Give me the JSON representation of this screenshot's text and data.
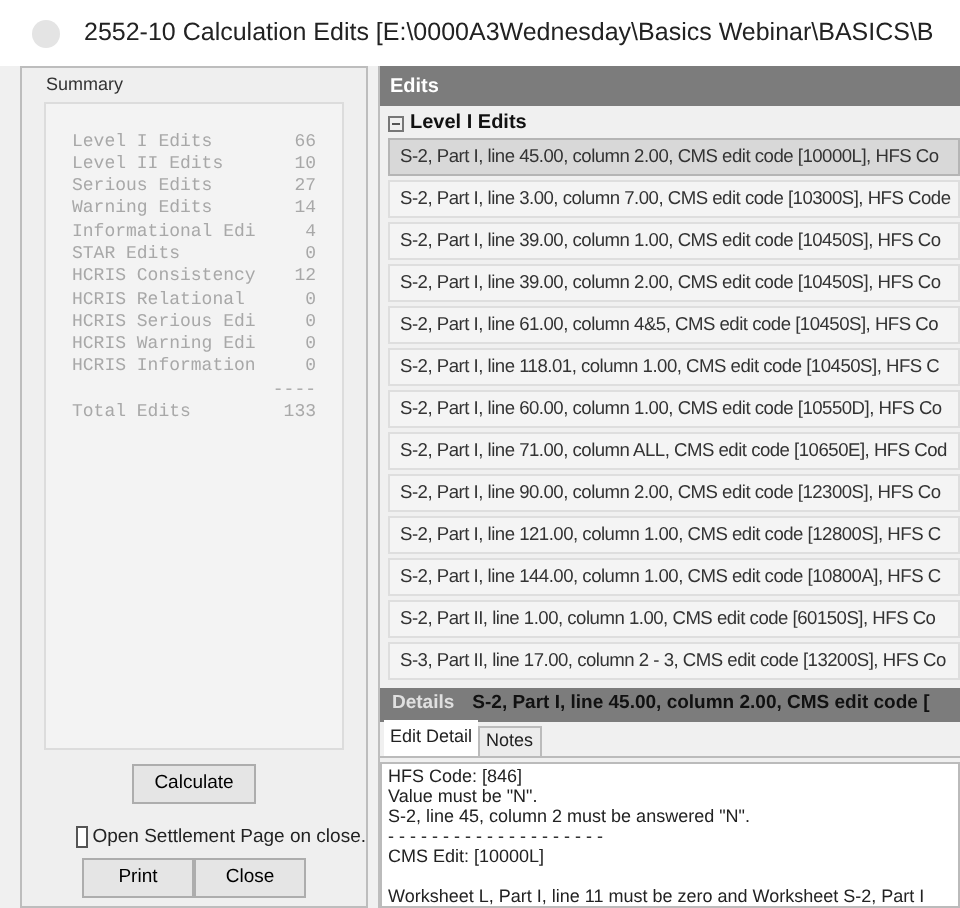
{
  "window": {
    "title": "2552-10 Calculation Edits [E:\\0000A3Wednesday\\Basics Webinar\\BASICS\\B"
  },
  "summary": {
    "title": "Summary",
    "rows": [
      {
        "label": "Level I Edits",
        "value": "66"
      },
      {
        "label": "Level II Edits",
        "value": "10"
      },
      {
        "label": "Serious Edits",
        "value": "27"
      },
      {
        "label": "Warning Edits",
        "value": "14"
      },
      {
        "label": "Informational Edi",
        "value": "4"
      },
      {
        "label": "STAR Edits",
        "value": "0"
      },
      {
        "label": "HCRIS Consistency",
        "value": "12"
      },
      {
        "label": "HCRIS Relational",
        "value": "0"
      },
      {
        "label": "HCRIS Serious Edi",
        "value": "0"
      },
      {
        "label": "HCRIS Warning Edi",
        "value": "0"
      },
      {
        "label": "HCRIS Information",
        "value": "0"
      }
    ],
    "separator": "----",
    "total": {
      "label": "Total Edits",
      "value": "133"
    },
    "calculate_button": "Calculate",
    "open_settlement": {
      "label": "Open Settlement Page on close.",
      "checked": false
    },
    "buttons": [
      "Print",
      "Close"
    ]
  },
  "edits": {
    "title": "Edits",
    "group": {
      "label": "Level I Edits",
      "expanded": true
    },
    "rows": [
      {
        "text": "S-2, Part I, line 45.00, column 2.00, CMS edit code [10000L], HFS Co",
        "selected": true
      },
      {
        "text": "S-2, Part I, line 3.00, column 7.00, CMS edit code [10300S], HFS Code",
        "selected": false
      },
      {
        "text": "S-2, Part I, line 39.00, column 1.00, CMS edit code [10450S], HFS Co",
        "selected": false
      },
      {
        "text": "S-2, Part I, line 39.00, column 2.00, CMS edit code [10450S], HFS Co",
        "selected": false
      },
      {
        "text": "S-2, Part I, line 61.00, column 4&5, CMS edit code [10450S], HFS Co",
        "selected": false
      },
      {
        "text": "S-2, Part I, line 118.01, column 1.00, CMS edit code [10450S], HFS C",
        "selected": false
      },
      {
        "text": "S-2, Part I, line 60.00, column 1.00, CMS edit code [10550D], HFS Co",
        "selected": false
      },
      {
        "text": "S-2, Part I, line 71.00, column ALL, CMS edit code [10650E], HFS Cod",
        "selected": false
      },
      {
        "text": "S-2, Part I, line 90.00, column 2.00, CMS edit code [12300S], HFS Co",
        "selected": false
      },
      {
        "text": "S-2, Part I, line 121.00, column 1.00, CMS edit code [12800S], HFS C",
        "selected": false
      },
      {
        "text": "S-2, Part I, line 144.00, column 1.00, CMS edit code [10800A], HFS C",
        "selected": false
      },
      {
        "text": "S-2, Part II, line 1.00, column 1.00, CMS edit code [60150S], HFS Co",
        "selected": false
      },
      {
        "text": "S-3, Part II, line 17.00, column 2 - 3, CMS edit code [13200S], HFS Co",
        "selected": false
      }
    ]
  },
  "details": {
    "title": "Details",
    "heading": "S-2, Part I, line 45.00, column 2.00, CMS edit code [",
    "tabs": [
      {
        "label": "Edit Detail",
        "selected": true
      },
      {
        "label": "Notes",
        "selected": false
      }
    ],
    "lines": [
      {
        "text": "HFS Code: [846]",
        "spaced": false
      },
      {
        "text": "Value must be \"N\".",
        "spaced": false
      },
      {
        "text": "S-2, line 45, column 2 must be answered \"N\".",
        "spaced": false
      },
      {
        "text": "- - - - - - - - - - - - - - - - - - - -",
        "spaced": false
      },
      {
        "text": "CMS Edit: [10000L]",
        "spaced": false
      },
      {
        "text": "Worksheet L, Part I, line 11 must be zero and Worksheet S-2, Part I",
        "spaced": true
      }
    ]
  }
}
